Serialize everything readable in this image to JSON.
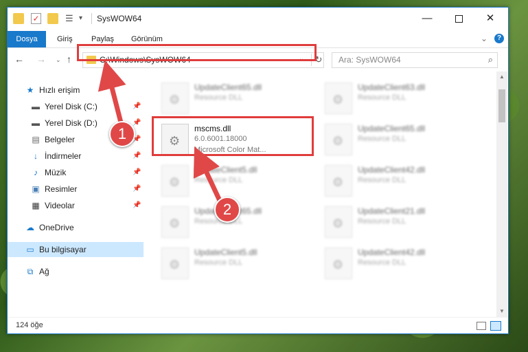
{
  "window": {
    "title": "SysWOW64",
    "min_glyph": "—",
    "close_glyph": "✕"
  },
  "ribbon": {
    "tabs": [
      "Dosya",
      "Giriş",
      "Paylaş",
      "Görünüm"
    ],
    "help_glyph": "?",
    "expand_glyph": "⌄"
  },
  "nav": {
    "back_glyph": "←",
    "forward_glyph": "→",
    "recent_glyph": "⌄",
    "up_glyph": "↑",
    "address": "C:\\Windows\\SysWOW64",
    "search_placeholder": "Ara: SysWOW64"
  },
  "sidebar": {
    "items": [
      {
        "label": "Hızlı erişim",
        "icon": "star-icon",
        "pinned": false
      },
      {
        "label": "Yerel Disk (C:)",
        "icon": "drive-icon",
        "pinned": true
      },
      {
        "label": "Yerel Disk (D:)",
        "icon": "drive-icon",
        "pinned": true
      },
      {
        "label": "Belgeler",
        "icon": "documents-icon",
        "pinned": true
      },
      {
        "label": "İndirmeler",
        "icon": "download-icon",
        "pinned": true
      },
      {
        "label": "Müzik",
        "icon": "music-icon",
        "pinned": true
      },
      {
        "label": "Resimler",
        "icon": "pictures-icon",
        "pinned": true
      },
      {
        "label": "Videolar",
        "icon": "video-icon",
        "pinned": true
      },
      {
        "label": "OneDrive",
        "icon": "cloud-icon",
        "pinned": false
      },
      {
        "label": "Bu bilgisayar",
        "icon": "computer-icon",
        "pinned": false,
        "selected": true
      },
      {
        "label": "Ağ",
        "icon": "network-icon",
        "pinned": false
      }
    ]
  },
  "files": [
    {
      "name": "UpdateClient65.dll",
      "line2": "Resource DLL",
      "line3": "",
      "blurred": true
    },
    {
      "name": "UpdateClient63.dll",
      "line2": "Resource DLL",
      "line3": "",
      "blurred": true
    },
    {
      "name": "mscms.dll",
      "line2": "6.0.6001.18000",
      "line3": "Microsoft Color Mat...",
      "blurred": false
    },
    {
      "name": "UpdateClient65.dll",
      "line2": "Resource DLL",
      "line3": "",
      "blurred": true
    },
    {
      "name": "UpdateClient5.dll",
      "line2": "Resource DLL",
      "line3": "",
      "blurred": true
    },
    {
      "name": "UpdateClient42.dll",
      "line2": "Resource DLL",
      "line3": "",
      "blurred": true
    },
    {
      "name": "UpdateClient65.dll",
      "line2": "Resource DLL",
      "line3": "",
      "blurred": true
    },
    {
      "name": "UpdateClient21.dll",
      "line2": "Resource DLL",
      "line3": "",
      "blurred": true
    },
    {
      "name": "UpdateClient5.dll",
      "line2": "Resource DLL",
      "line3": "",
      "blurred": true
    },
    {
      "name": "UpdateClient42.dll",
      "line2": "Resource DLL",
      "line3": "",
      "blurred": true
    }
  ],
  "status": {
    "item_count": "124 öğe"
  },
  "annotations": {
    "step1": "1",
    "step2": "2",
    "highlight_color": "#e03c3c"
  }
}
